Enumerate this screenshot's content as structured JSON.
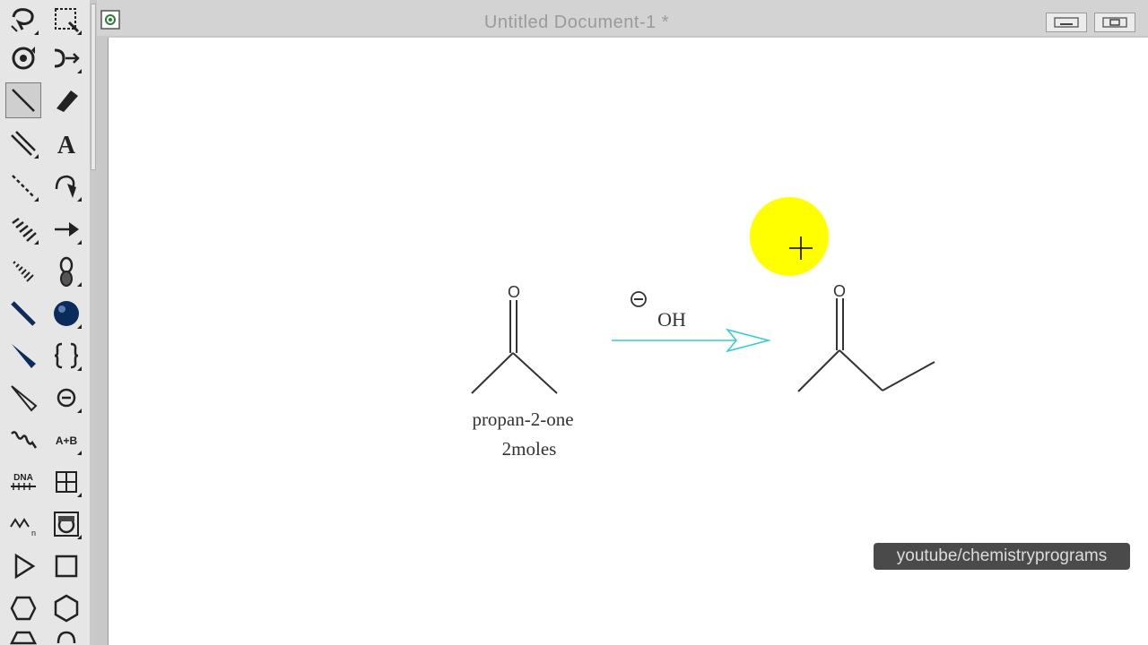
{
  "window": {
    "title": "Untitled Document-1 *"
  },
  "palette": {
    "tools": [
      {
        "name": "lasso-select-tool",
        "icon": "lasso-icon",
        "selected": false
      },
      {
        "name": "marquee-select-tool",
        "icon": "marquee-icon",
        "selected": false
      },
      {
        "name": "rotate-tool",
        "icon": "rotate-icon",
        "selected": false
      },
      {
        "name": "mass-fragment-tool",
        "icon": "fragment-icon",
        "selected": false
      },
      {
        "name": "solid-bond-tool",
        "icon": "single-bond-icon",
        "selected": true
      },
      {
        "name": "eraser-tool",
        "icon": "eraser-icon",
        "selected": false
      },
      {
        "name": "multiple-bond-tool",
        "icon": "double-bond-icon",
        "selected": false
      },
      {
        "name": "text-tool",
        "icon": "text-a-icon",
        "selected": false
      },
      {
        "name": "dashed-bond-tool",
        "icon": "dashed-bond-icon",
        "selected": false
      },
      {
        "name": "pen-tool",
        "icon": "pen-icon",
        "selected": false
      },
      {
        "name": "hashed-bond-tool",
        "icon": "hashed-bond-icon",
        "selected": false
      },
      {
        "name": "arrow-tool",
        "icon": "arrow-icon",
        "selected": false
      },
      {
        "name": "hashed-wedge-tool",
        "icon": "hashed-wedge-icon",
        "selected": false
      },
      {
        "name": "orbital-tool",
        "icon": "orbital-icon",
        "selected": false
      },
      {
        "name": "bold-bond-tool",
        "icon": "bold-bond-icon",
        "selected": false
      },
      {
        "name": "sphere-tool",
        "icon": "sphere-icon",
        "selected": false
      },
      {
        "name": "wedge-bond-tool",
        "icon": "wedge-bond-icon",
        "selected": false
      },
      {
        "name": "bracket-tool",
        "icon": "bracket-icon",
        "selected": false
      },
      {
        "name": "hollow-wedge-tool",
        "icon": "hollow-wedge-icon",
        "selected": false
      },
      {
        "name": "charge-tool",
        "icon": "charge-minus-icon",
        "selected": false
      },
      {
        "name": "wavy-bond-tool",
        "icon": "wavy-bond-icon",
        "selected": false
      },
      {
        "name": "reaction-tool",
        "icon": "reaction-icon",
        "selected": false,
        "label": "A+B"
      },
      {
        "name": "dna-tool",
        "icon": "dna-icon",
        "selected": false,
        "label": "DNA"
      },
      {
        "name": "table-tool",
        "icon": "table-icon",
        "selected": false
      },
      {
        "name": "chain-tool",
        "icon": "chain-icon",
        "selected": false
      },
      {
        "name": "template-tool",
        "icon": "template-icon",
        "selected": false
      },
      {
        "name": "triangle-shape-tool",
        "icon": "triangle-icon",
        "selected": false
      },
      {
        "name": "square-shape-tool",
        "icon": "square-icon",
        "selected": false
      },
      {
        "name": "cyclohexane-chair-tool",
        "icon": "cyclohexane-ring-icon",
        "selected": false
      },
      {
        "name": "benzene-ring-tool",
        "icon": "hexagon-ring-icon",
        "selected": false
      }
    ]
  },
  "drawing": {
    "reactant_atom": "O",
    "product_atom": "O",
    "catalyst": "OH",
    "catalyst_charge": "-",
    "reactant_label_line1": "propan-2-one",
    "reactant_label_line2": "2moles",
    "arrow_color": "#33cccc",
    "cursor_highlight_color": "#ffff00"
  },
  "watermark": "youtube/chemistryprograms",
  "colors": {
    "palette_bg": "#e6e6e6",
    "canvas_bg": "#ffffff",
    "titlebar_bg": "#d3d3d3"
  }
}
